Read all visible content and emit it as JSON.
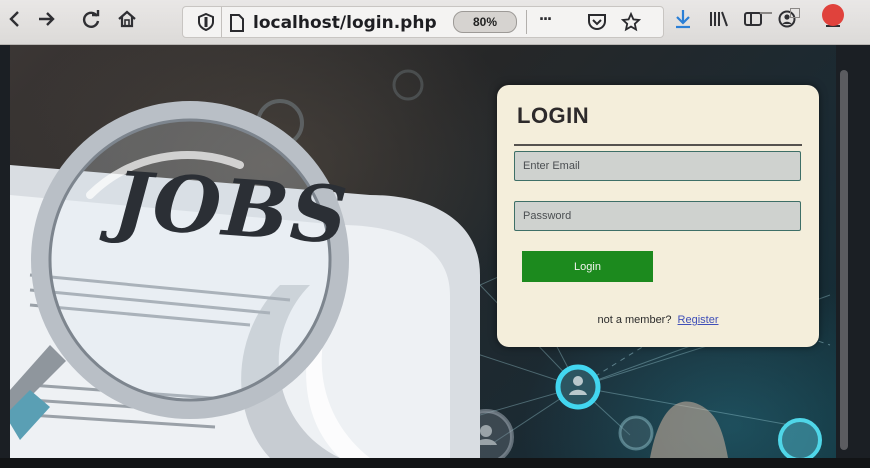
{
  "browser": {
    "url": "localhost/login.php",
    "zoom": "80%",
    "overflow_label": "···"
  },
  "hero": {
    "word": "JOBS"
  },
  "login": {
    "title": "LOGIN",
    "email_placeholder": "Enter Email",
    "password_placeholder": "Password",
    "button_label": "Login",
    "member_text": "not a member?",
    "register_link": "Register"
  },
  "colors": {
    "card_bg": "#f4eedb",
    "button": "#1c8a1e",
    "field_border": "#3e6f67",
    "link": "#3f4fb8"
  }
}
